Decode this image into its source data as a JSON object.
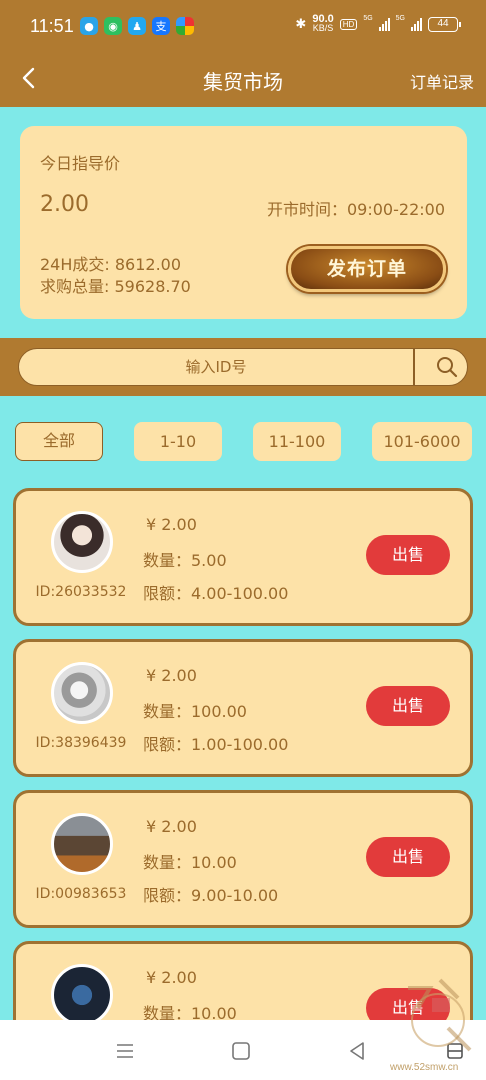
{
  "status": {
    "time": "11:51",
    "net_speed_value": "90.0",
    "net_speed_unit": "KB/S",
    "hd": "HD",
    "sig1": "5G",
    "sig2": "5G",
    "battery": "44"
  },
  "header": {
    "title": "集贸市场",
    "order_link": "订单记录"
  },
  "info": {
    "today_label": "今日指导价",
    "price": "2.00",
    "open_time": "开市时间：09:00-22:00",
    "vol_24h": "24H成交: 8612.00",
    "total_buy": "求购总量: 59628.70",
    "publish_label": "发布订单"
  },
  "search": {
    "placeholder": "输入ID号"
  },
  "filters": [
    "全部",
    "1-10",
    "11-100",
    "101-6000"
  ],
  "orders": [
    {
      "price": "¥ 2.00",
      "qty": "数量：5.00",
      "limit": "限额：4.00-100.00",
      "id": "ID:26033532",
      "action": "出售",
      "avatar_color": "#d8d2cc"
    },
    {
      "price": "¥ 2.00",
      "qty": "数量：100.00",
      "limit": "限额：1.00-100.00",
      "id": "ID:38396439",
      "action": "出售",
      "avatar_color": "#c9c9c9"
    },
    {
      "price": "¥ 2.00",
      "qty": "数量：10.00",
      "limit": "限额：9.00-10.00",
      "id": "ID:00983653",
      "action": "出售",
      "avatar_color": "#6d5843"
    },
    {
      "price": "¥ 2.00",
      "qty": "数量：10.00",
      "limit": "",
      "id": "",
      "action": "出售",
      "avatar_color": "#2a3a55"
    }
  ],
  "watermark": "www.52smw.cn",
  "colors": {
    "header_bg": "#b07a30",
    "page_bg": "#7fe9e8",
    "card_bg": "#fde2a8",
    "text_brown": "#9b6b2c",
    "sell_red": "#e23b3b"
  }
}
